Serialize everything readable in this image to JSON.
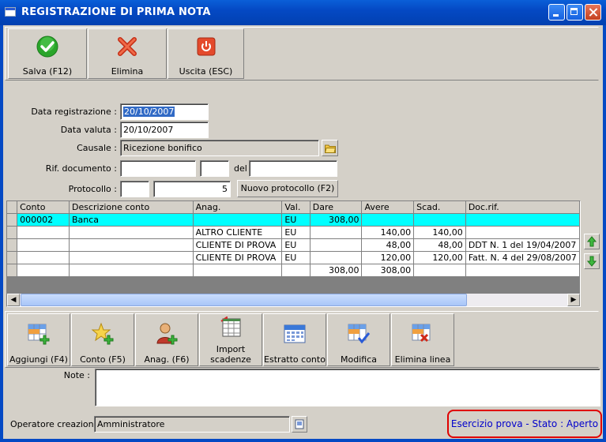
{
  "window": {
    "title": "REGISTRAZIONE DI PRIMA NOTA"
  },
  "toolbar": {
    "save_label": "Salva (F12)",
    "delete_label": "Elimina",
    "exit_label": "Uscita (ESC)"
  },
  "form": {
    "data_registrazione_label": "Data registrazione :",
    "data_registrazione_value": "20/10/2007",
    "data_valuta_label": "Data valuta :",
    "data_valuta_value": "20/10/2007",
    "causale_label": "Causale :",
    "causale_value": "Ricezione bonifico",
    "rif_documento_label": "Rif. documento :",
    "del_label": "del",
    "protocollo_label": "Protocollo :",
    "protocollo_number": "5",
    "nuovo_protocollo_label": "Nuovo protocollo (F2)"
  },
  "grid": {
    "columns": [
      "Conto",
      "Descrizione conto",
      "Anag.",
      "Val.",
      "Dare",
      "Avere",
      "Scad.",
      "Doc.rif."
    ],
    "rows": [
      {
        "conto": "000002",
        "descrizione": "Banca",
        "anag": "",
        "val": "EU",
        "dare": "308,00",
        "avere": "",
        "scad": "",
        "docrif": ""
      },
      {
        "conto": "",
        "descrizione": "",
        "anag": "ALTRO CLIENTE",
        "val": "EU",
        "dare": "",
        "avere": "140,00",
        "scad": "140,00",
        "docrif": ""
      },
      {
        "conto": "",
        "descrizione": "",
        "anag": "CLIENTE DI PROVA",
        "val": "EU",
        "dare": "",
        "avere": "48,00",
        "scad": "48,00",
        "docrif": "DDT N. 1 del 19/04/2007"
      },
      {
        "conto": "",
        "descrizione": "",
        "anag": "CLIENTE DI PROVA",
        "val": "EU",
        "dare": "",
        "avere": "120,00",
        "scad": "120,00",
        "docrif": "Fatt. N. 4 del 29/08/2007"
      }
    ],
    "totals": {
      "dare": "308,00",
      "avere": "308,00"
    }
  },
  "actions": {
    "aggiungi": "Aggiungi (F4)",
    "conto": "Conto (F5)",
    "anag": "Anag. (F6)",
    "import_1": "Import",
    "import_2": "scadenze",
    "estratto": "Estratto conto",
    "modifica": "Modifica",
    "elimina_linea": "Elimina linea"
  },
  "note": {
    "label": "Note :"
  },
  "operatore": {
    "label": "Operatore creazione :",
    "value": "Amministratore"
  },
  "status": {
    "text": "Esercizio prova - Stato : Aperto"
  },
  "colors": {
    "titlebar": "#0449c4",
    "selected_row": "#00ffff",
    "status_text": "#0000cc",
    "status_border": "#e00000"
  }
}
